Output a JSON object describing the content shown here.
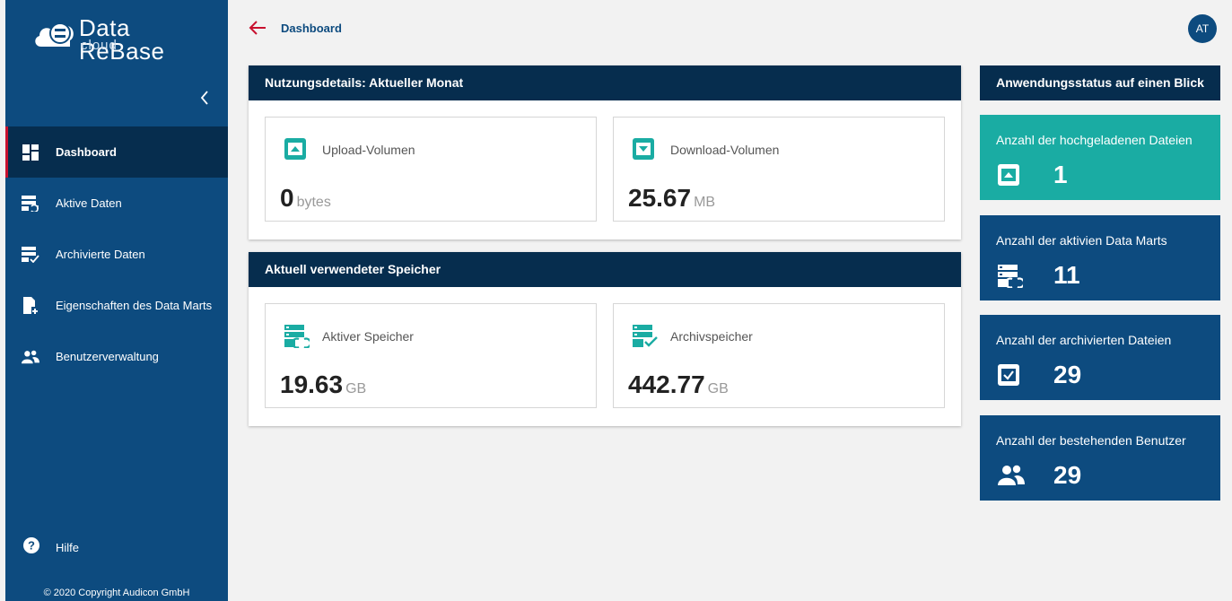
{
  "sidebar": {
    "brand": "Data ReBase",
    "brand_sub": "cloud",
    "collapse_icon": "chevron-left-icon",
    "items": [
      {
        "label": "Dashboard",
        "icon": "dashboard-grid-icon",
        "active": true
      },
      {
        "label": "Aktive Daten",
        "icon": "active-data-icon",
        "active": false
      },
      {
        "label": "Archivierte Daten",
        "icon": "archived-data-icon",
        "active": false
      },
      {
        "label": "Eigenschaften des Data Marts",
        "icon": "add-file-icon",
        "active": false
      },
      {
        "label": "Benutzerverwaltung",
        "icon": "users-icon",
        "active": false
      }
    ],
    "help": {
      "label": "Hilfe",
      "icon": "help-icon"
    },
    "copyright": "© 2020 Copyright Audicon GmbH"
  },
  "header": {
    "breadcrumb": "Dashboard",
    "back_icon": "arrow-left-icon",
    "avatar_initials": "AT"
  },
  "usage": {
    "title": "Nutzungsdetails: Aktueller Monat",
    "upload": {
      "label": "Upload-Volumen",
      "value": "0",
      "unit": "bytes",
      "icon": "upload-box-icon"
    },
    "download": {
      "label": "Download-Volumen",
      "value": "25.67",
      "unit": "MB",
      "icon": "download-box-icon"
    }
  },
  "storage": {
    "title": "Aktuell verwendeter Speicher",
    "active": {
      "label": "Aktiver Speicher",
      "value": "19.63",
      "unit": "GB",
      "icon": "active-storage-icon"
    },
    "archive": {
      "label": "Archivspeicher",
      "value": "442.77",
      "unit": "GB",
      "icon": "archive-storage-icon"
    }
  },
  "status": {
    "title": "Anwendungsstatus auf einen Blick",
    "cards": [
      {
        "label": "Anzahl der hochgeladenen Dateien",
        "value": "1",
        "icon": "upload-box-icon",
        "color": "#1aaca3"
      },
      {
        "label": "Anzahl der aktivien Data Marts",
        "value": "11",
        "icon": "active-data-icon",
        "color": "#0d4b7f"
      },
      {
        "label": "Anzahl der archivierten Dateien",
        "value": "29",
        "icon": "check-box-icon",
        "color": "#0d4b7f"
      },
      {
        "label": "Anzahl der bestehenden Benutzer",
        "value": "29",
        "icon": "users-icon",
        "color": "#0d4b7f"
      }
    ]
  },
  "colors": {
    "primary": "#0d4b7f",
    "dark": "#062d4e",
    "teal": "#1aaca3",
    "accent": "#c8102e"
  }
}
